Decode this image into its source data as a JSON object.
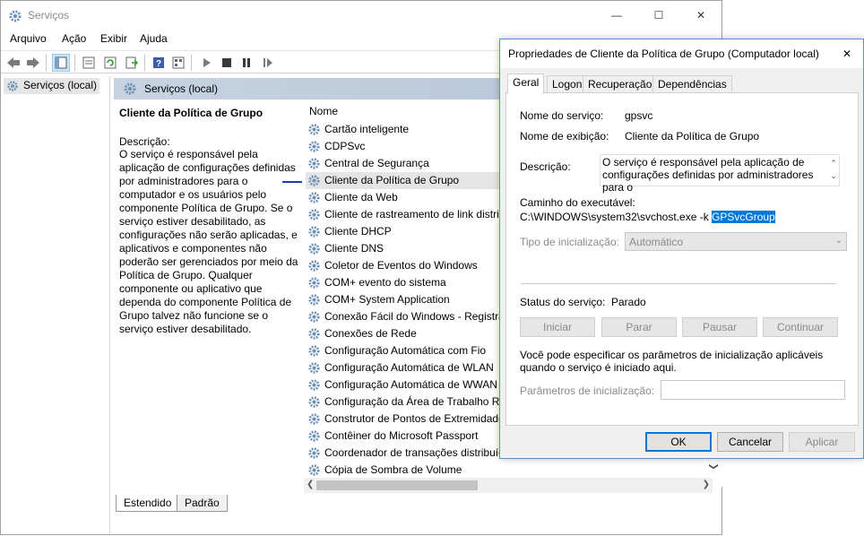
{
  "window": {
    "title": "Serviços",
    "minimize_glyph": "—",
    "maximize_glyph": "☐",
    "close_glyph": "✕"
  },
  "menu": [
    "Arquivo",
    "Ação",
    "Exibir",
    "Ajuda"
  ],
  "toolbar_icons": [
    "back-icon",
    "forward-icon",
    "show-tree-icon",
    "properties-icon",
    "refresh-icon",
    "export-icon",
    "help-icon",
    "view-icon",
    "start-icon",
    "stop-icon",
    "pause-icon",
    "restart-icon"
  ],
  "tree": {
    "root": "Serviços (local)"
  },
  "pane_header": "Serviços (local)",
  "details": {
    "title": "Cliente da Política de Grupo",
    "desc_label": "Descrição:",
    "desc_text": "O serviço é responsável pela aplicação de configurações definidas por administradores para o computador e os usuários pelo componente Política de Grupo. Se o serviço estiver desabilitado, as configurações não serão aplicadas, e aplicativos e componentes não poderão ser gerenciados por meio da Política de Grupo. Qualquer componente ou aplicativo que dependa do componente Política de Grupo talvez não funcione se o serviço estiver desabilitado."
  },
  "list": {
    "column": "Nome",
    "selected_index": 3,
    "items": [
      "Cartão inteligente",
      "CDPSvc",
      "Central de Segurança",
      "Cliente da Política de Grupo",
      "Cliente da Web",
      "Cliente de rastreamento de link distribuído",
      "Cliente DHCP",
      "Cliente DNS",
      "Coletor de Eventos do Windows",
      "COM+ evento do sistema",
      "COM+ System Application",
      "Conexão Fácil do Windows - Registrador",
      "Conexões de Rede",
      "Configuração Automática com Fio",
      "Configuração Automática de WLAN",
      "Configuração Automática de WWAN",
      "Configuração da Área de Trabalho Remota",
      "Construtor de Pontos de Extremidade",
      "Contêiner do Microsoft Passport",
      "Coordenador de transações distribuídas",
      "Cópia de Sombra de Volume"
    ]
  },
  "bottom_tabs": [
    "Estendido",
    "Padrão"
  ],
  "scroll_glyphs": {
    "left": "❮",
    "right": "❯",
    "down": "❯"
  },
  "dialog": {
    "title": "Propriedades de Cliente da Política de Grupo (Computador local)",
    "close_glyph": "✕",
    "tabs": [
      "Geral",
      "Logon",
      "Recuperação",
      "Dependências"
    ],
    "service_name_label": "Nome do serviço:",
    "service_name": "gpsvc",
    "display_name_label": "Nome de exibição:",
    "display_name": "Cliente da Política de Grupo",
    "description_label": "Descrição:",
    "description": "O serviço é responsável pela aplicação de configurações definidas por administradores para o",
    "exe_path_label": "Caminho do executável:",
    "exe_path_prefix": "C:\\WINDOWS\\system32\\svchost.exe -k ",
    "exe_path_selected": "GPSvcGroup",
    "startup_type_label": "Tipo de inicialização:",
    "startup_type_value": "Automático",
    "status_label": "Status do serviço:",
    "status_value": "Parado",
    "service_buttons": [
      "Iniciar",
      "Parar",
      "Pausar",
      "Continuar"
    ],
    "params_note": "Você pode especificar os parâmetros de inicialização aplicáveis quando o serviço é iniciado aqui.",
    "params_label": "Parâmetros de inicialização:",
    "params_value": "",
    "ok": "OK",
    "cancel": "Cancelar",
    "apply": "Aplicar"
  },
  "colors": {
    "selection": "#0078d7",
    "header_gradient_start": "#c7d3e1",
    "connector": "#1f3ea6"
  }
}
